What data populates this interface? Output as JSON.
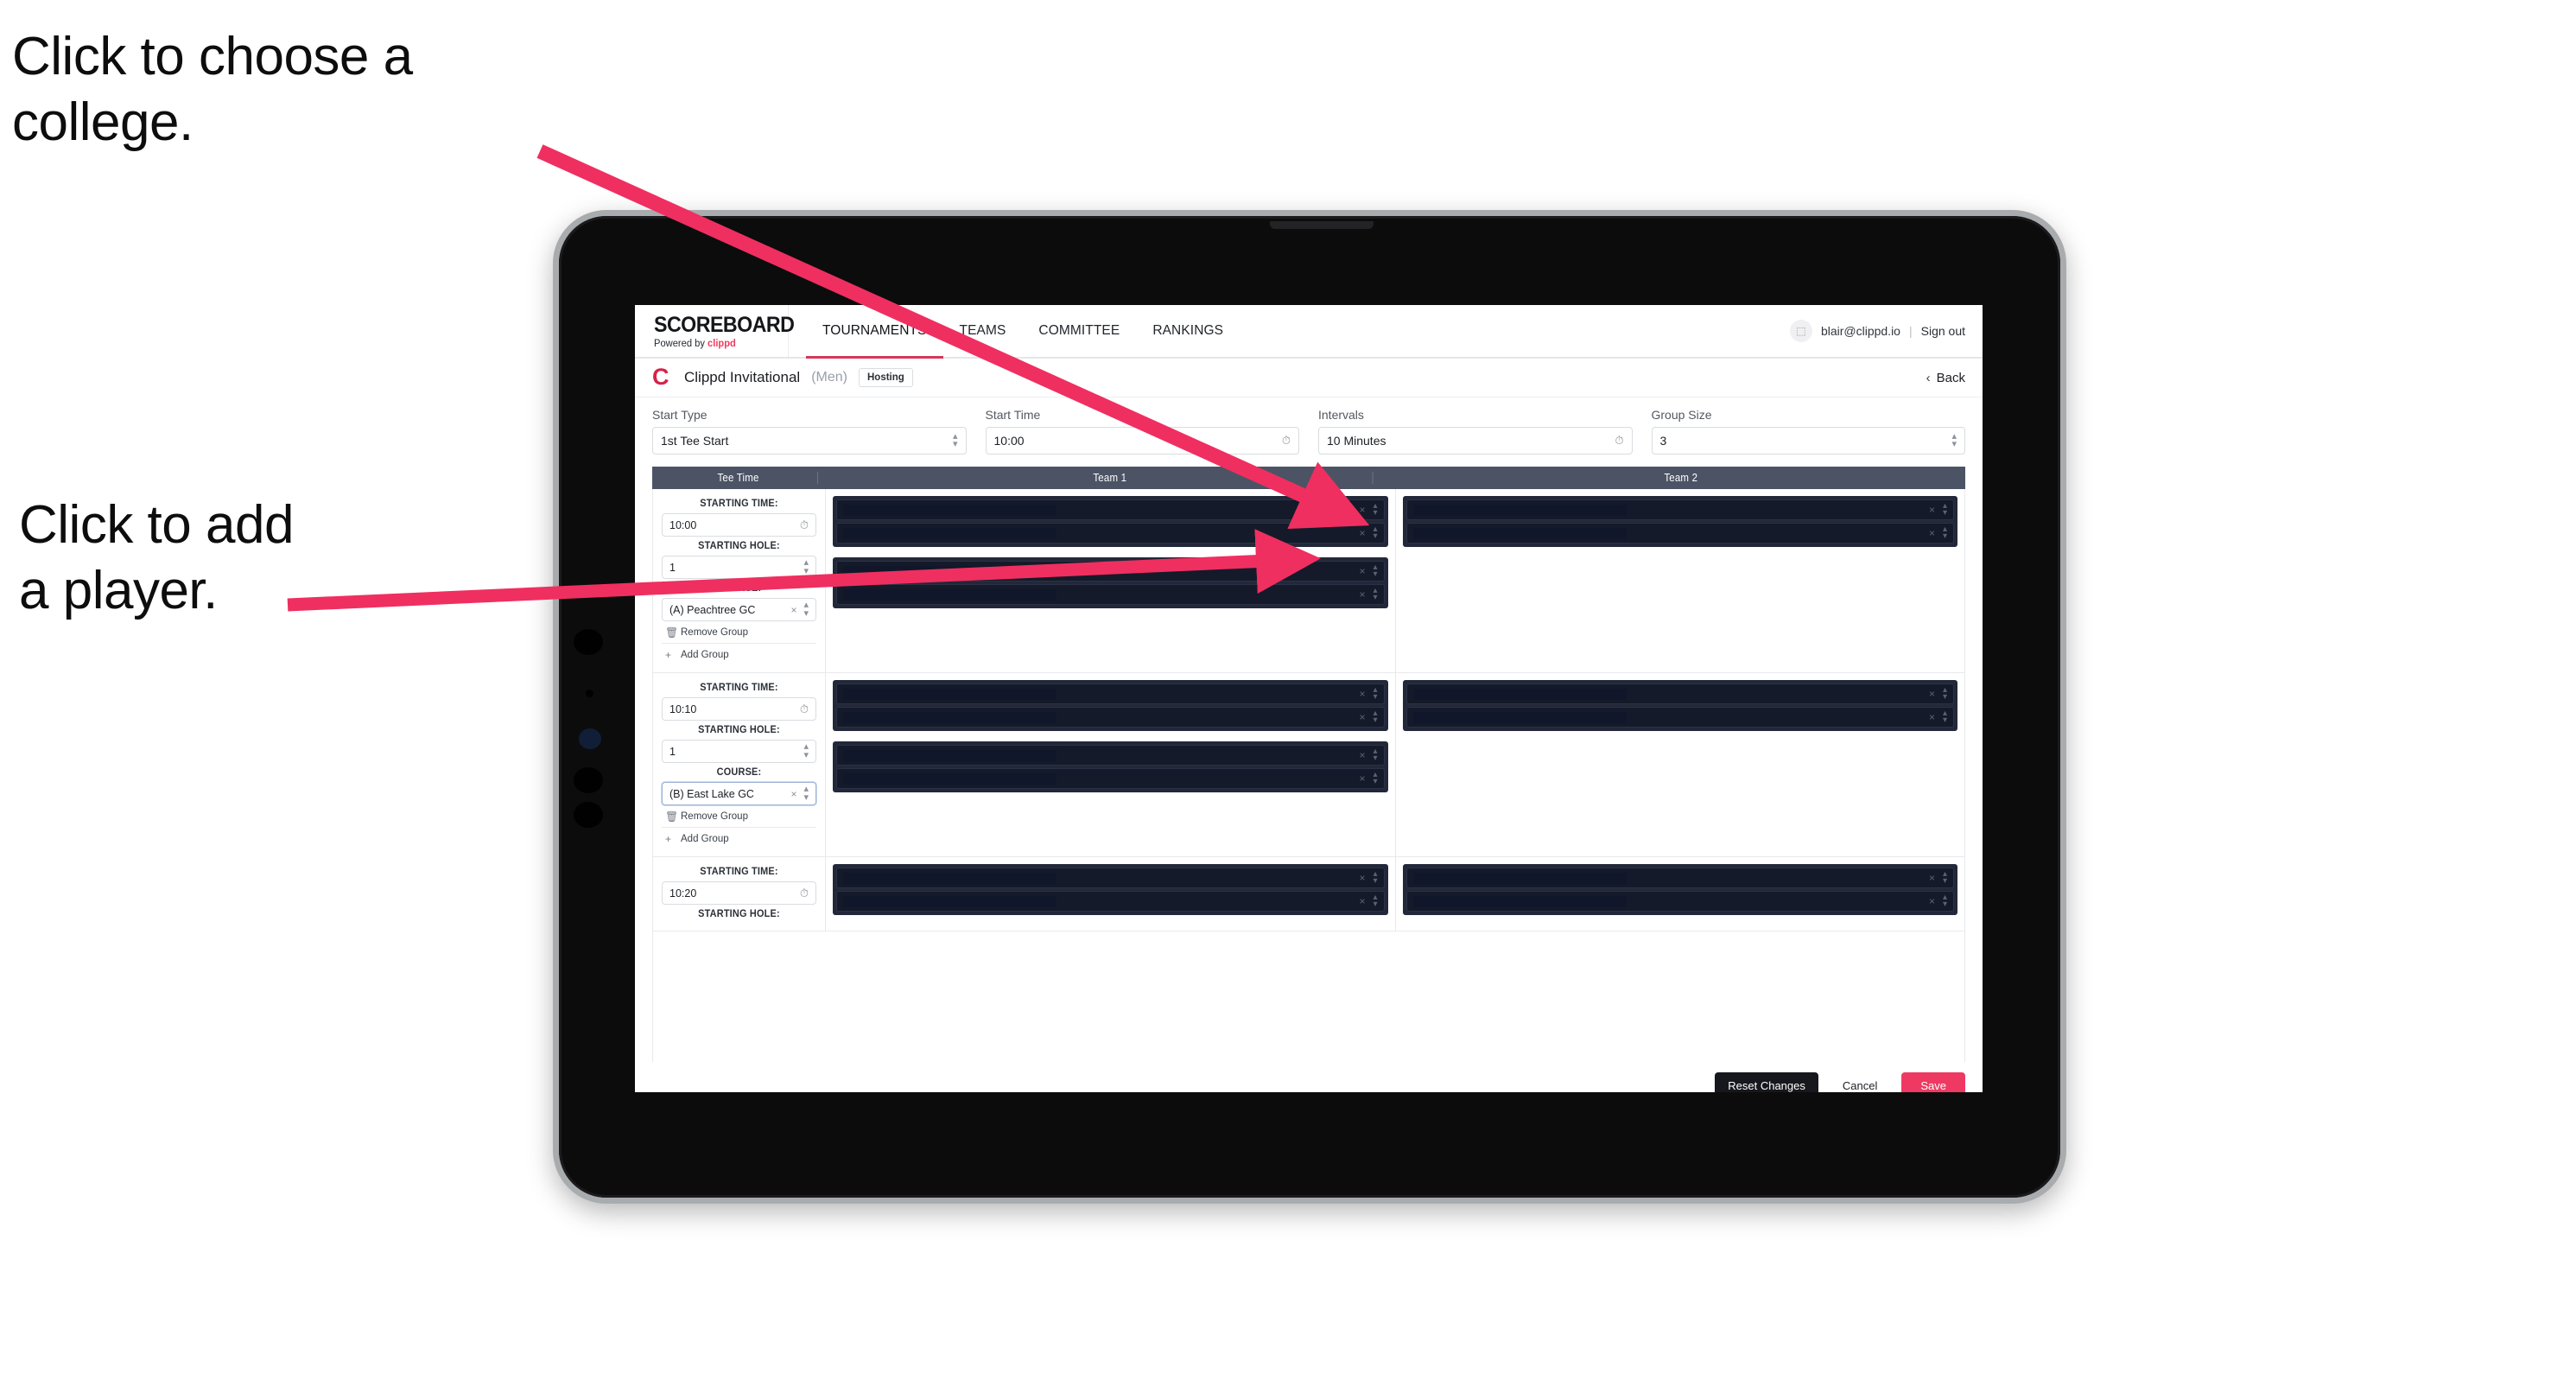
{
  "annotations": [
    {
      "id": "choose-college",
      "text": "Click to choose a\ncollege."
    },
    {
      "id": "add-player",
      "text": "Click to add\na player."
    }
  ],
  "accent": {
    "pink": "#ee3a62",
    "arrow_pink": "#ef2f60",
    "navbar_dark": "#4c5365",
    "panel_dark": "#222839"
  },
  "topnav": {
    "brand_title": "SCOREBOARD",
    "brand_sub_prefix": "Powered by ",
    "brand_sub_accent": "clippd",
    "links": [
      {
        "label": "TOURNAMENTS",
        "active": true
      },
      {
        "label": "TEAMS",
        "active": false
      },
      {
        "label": "COMMITTEE",
        "active": false
      },
      {
        "label": "RANKINGS",
        "active": false
      }
    ],
    "avatar_glyph": "⬚",
    "user_email": "blair@clippd.io",
    "separator": "|",
    "sign_out": "Sign out"
  },
  "tournament_bar": {
    "logo_glyph": "C",
    "name": "Clippd Invitational",
    "gender": "(Men)",
    "badge": "Hosting",
    "back_chevron": "‹",
    "back_label": "Back"
  },
  "settings": [
    {
      "label": "Start Type",
      "value": "1st Tee Start",
      "icon": "stepper-icon"
    },
    {
      "label": "Start Time",
      "value": "10:00",
      "icon": "clock-icon"
    },
    {
      "label": "Intervals",
      "value": "10 Minutes",
      "icon": "clock-icon"
    },
    {
      "label": "Group Size",
      "value": "3",
      "icon": "stepper-icon"
    }
  ],
  "table": {
    "headers": {
      "tee_time": "Tee Time",
      "team1": "Team 1",
      "team2": "Team 2"
    },
    "field_labels": {
      "starting_time": "STARTING TIME:",
      "starting_hole": "STARTING HOLE:",
      "course": "COURSE:"
    },
    "group_actions": {
      "remove_label": "Remove Group",
      "remove_icon": "trash-icon",
      "add_label": "Add Group",
      "add_icon": "plus-icon"
    },
    "row_icons": {
      "clear": "×",
      "stepper": "stepper-icon"
    },
    "groups": [
      {
        "starting_time": "10:00",
        "starting_hole": "1",
        "course": "(A) Peachtree GC",
        "course_focused": false,
        "team1_panes": [
          2,
          2
        ],
        "team2_panes": [
          2
        ]
      },
      {
        "starting_time": "10:10",
        "starting_hole": "1",
        "course": "(B) East Lake GC",
        "course_focused": true,
        "team1_panes": [
          2,
          2
        ],
        "team2_panes": [
          2
        ]
      },
      {
        "starting_time": "10:20",
        "starting_hole": "",
        "course": "",
        "course_focused": false,
        "team1_panes": [
          2
        ],
        "team2_panes": [
          2
        ]
      }
    ]
  },
  "footer": {
    "reset_label": "Reset Changes",
    "cancel_label": "Cancel",
    "save_label": "Save"
  }
}
